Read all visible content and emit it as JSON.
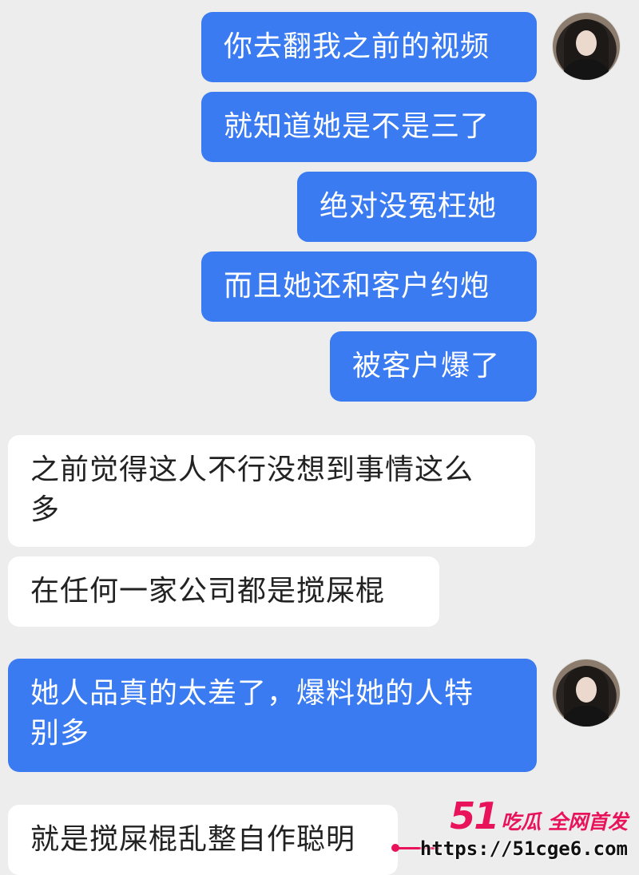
{
  "messages": [
    {
      "side": "sent",
      "text": "你去翻我之前的视频"
    },
    {
      "side": "sent",
      "text": "就知道她是不是三了"
    },
    {
      "side": "sent",
      "text": "绝对没冤枉她"
    },
    {
      "side": "sent",
      "text": "而且她还和客户约炮"
    },
    {
      "side": "sent",
      "text": "被客户爆了"
    },
    {
      "side": "received",
      "text": "之前觉得这人不行没想到事情这么\n多"
    },
    {
      "side": "received",
      "text": "在任何一家公司都是搅屎棍"
    },
    {
      "side": "sent",
      "text": "她人品真的太差了，爆料她的人特\n别多"
    },
    {
      "side": "received",
      "text": "就是搅屎棍乱整自作聪明"
    }
  ],
  "watermark": {
    "brand_number": "51",
    "brand_tag": "吃瓜 全网首发",
    "url": "https://51cge6.com"
  },
  "colors": {
    "background": "#ededed",
    "sent_bubble": "#3a7bf2",
    "received_bubble": "#ffffff",
    "watermark_accent": "#e8135a"
  }
}
